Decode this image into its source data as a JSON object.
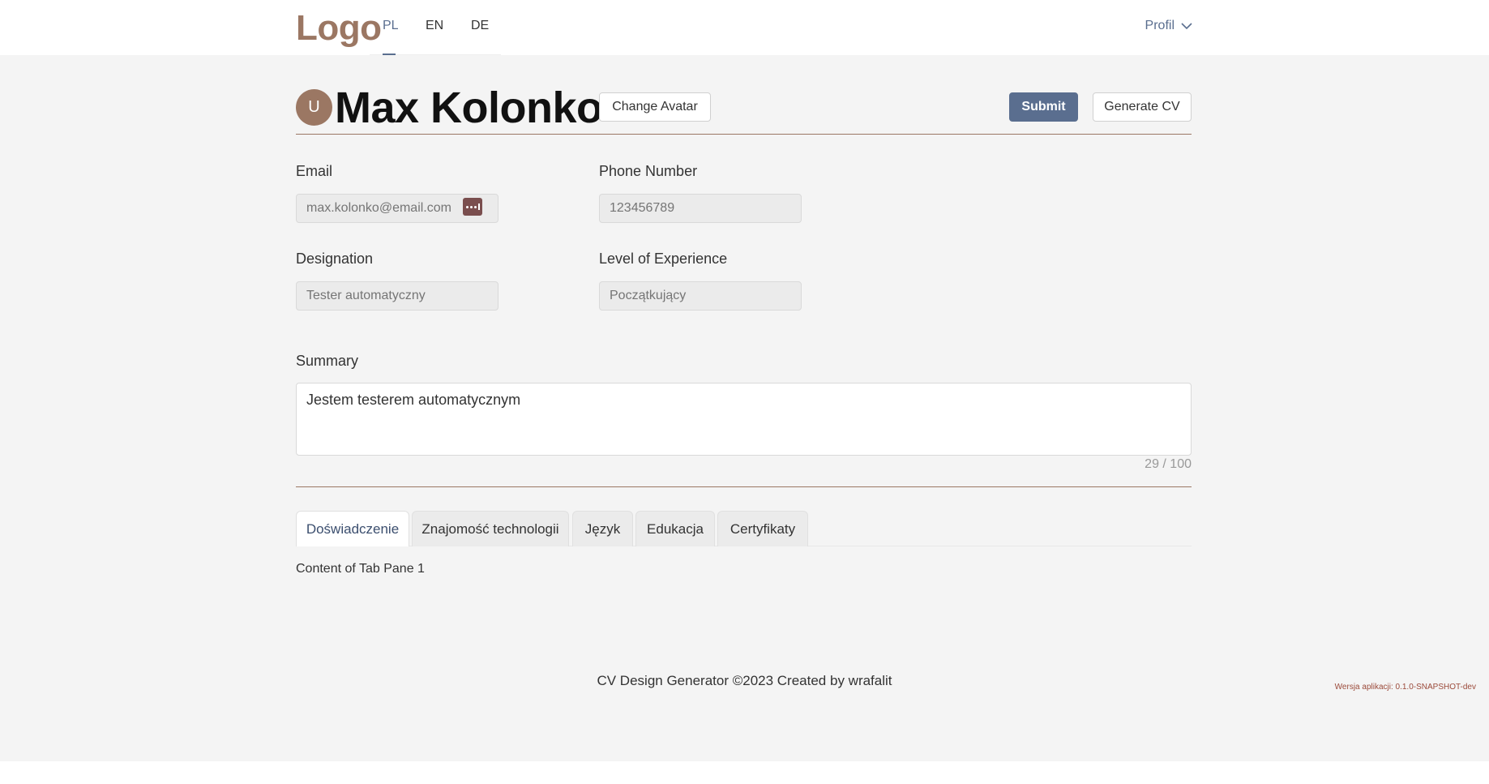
{
  "header": {
    "logo": "Logo",
    "languages": [
      {
        "label": "PL",
        "active": true
      },
      {
        "label": "EN",
        "active": false
      },
      {
        "label": "DE",
        "active": false
      }
    ],
    "profile_label": "Profil"
  },
  "profile": {
    "avatar_initial": "U",
    "name": "Max Kolonko",
    "change_avatar_label": "Change Avatar",
    "submit_label": "Submit",
    "generate_cv_label": "Generate CV"
  },
  "form": {
    "email": {
      "label": "Email",
      "placeholder": "max.kolonko@email.com"
    },
    "phone": {
      "label": "Phone Number",
      "placeholder": "123456789"
    },
    "designation": {
      "label": "Designation",
      "placeholder": "Tester automatyczny"
    },
    "experience": {
      "label": "Level of Experience",
      "placeholder": "Początkujący"
    },
    "summary": {
      "label": "Summary",
      "value": "Jestem testerem automatycznym",
      "counter": "29 / 100"
    }
  },
  "tabs": [
    {
      "label": "Doświadczenie",
      "active": true
    },
    {
      "label": "Znajomość technologii",
      "active": false
    },
    {
      "label": "Język",
      "active": false
    },
    {
      "label": "Edukacja",
      "active": false
    },
    {
      "label": "Certyfikaty",
      "active": false
    }
  ],
  "tab_content": "Content of Tab Pane 1",
  "footer": {
    "text": "CV Design Generator ©2023 Created by wrafalit",
    "version": "Wersja aplikacji: 0.1.0-SNAPSHOT-dev"
  },
  "colors": {
    "accent": "#9b7763",
    "primary": "#5a6e8f",
    "background": "#f4f4f4"
  },
  "icons": {
    "profile_dropdown": "chevron-down-icon",
    "password_manager": "more-dots-icon"
  }
}
